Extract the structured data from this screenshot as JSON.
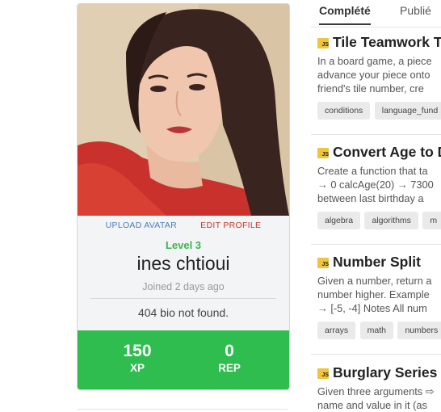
{
  "profile": {
    "upload_avatar": "UPLOAD AVATAR",
    "edit_profile": "EDIT PROFILE",
    "level": "Level 3",
    "name": "ines chtioui",
    "joined": "Joined 2 days ago",
    "bio": "404 bio not found.",
    "xp_value": "150",
    "xp_label": "XP",
    "rep_value": "0",
    "rep_label": "REP"
  },
  "tabs": [
    {
      "label": "Complété"
    },
    {
      "label": "Publié"
    }
  ],
  "challenges": [
    {
      "lang": "JS",
      "title": "Tile Teamwork T",
      "desc": [
        "In a board game, a piece",
        "advance your piece onto",
        "friend's tile number, cre"
      ],
      "tags": [
        "conditions",
        "language_fund"
      ]
    },
    {
      "lang": "JS",
      "title": "Convert Age to D",
      "desc": [
        "Create a function that ta",
        "→ 0 calcAge(20) → 7300",
        "between last birthday a"
      ],
      "tags": [
        "algebra",
        "algorithms",
        "m"
      ]
    },
    {
      "lang": "JS",
      "title": "Number Split",
      "desc": [
        "Given a number, return a",
        "number higher. Example",
        "→ [-5, -4] Notes All num"
      ],
      "tags": [
        "arrays",
        "math",
        "numbers"
      ]
    },
    {
      "lang": "JS",
      "title": "Burglary Series (",
      "desc": [
        "Given three arguments ⇨",
        "name and value in it (as"
      ],
      "tags": []
    }
  ],
  "colors": {
    "level_green": "#3ab54a",
    "stats_green": "#2ebd4e",
    "upload_blue": "#4a7bbd",
    "edit_red": "#c0392b",
    "js_badge": "#f0c53b"
  }
}
